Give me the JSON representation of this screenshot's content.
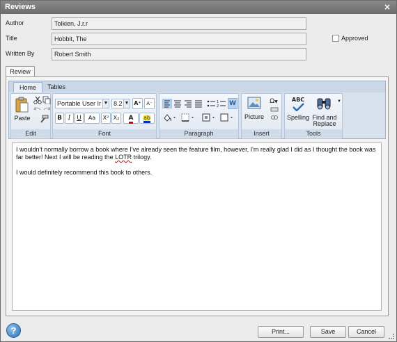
{
  "window": {
    "title": "Reviews",
    "close_glyph": "×"
  },
  "form": {
    "author_label": "Author",
    "author_value": "Tolkien, J.r.r",
    "title_label": "Title",
    "title_value": "Hobbit, The",
    "written_by_label": "Written By",
    "written_by_value": "Robert Smith",
    "approved_label": "Approved",
    "approved_checked": false
  },
  "tabs": {
    "review_tab": "Review"
  },
  "ribbon": {
    "tabs": [
      {
        "label": "Home",
        "active": true
      },
      {
        "label": "Tables",
        "active": false
      }
    ],
    "groups": {
      "edit": {
        "label": "Edit",
        "paste_label": "Paste",
        "icons": [
          "paste-icon",
          "cut-icon",
          "copy-icon",
          "undo-icon",
          "redo-icon",
          "format-painter-icon"
        ]
      },
      "font": {
        "label": "Font",
        "font_name": "Portable User Ir",
        "font_size": "8.2",
        "grow_glyph": "A⁺",
        "shrink_glyph": "A⁻",
        "bold": "B",
        "italic": "I",
        "underline": "U",
        "change_case": "Aa",
        "superscript": "X²",
        "subscript": "X₂",
        "font_color_glyph": "A",
        "highlight_glyph": "ab",
        "font_color": "#cc0000",
        "highlight_color": "#0033cc"
      },
      "paragraph": {
        "label": "Paragraph",
        "icons": [
          "align-left-icon",
          "align-center-icon",
          "align-right-icon",
          "justify-icon",
          "bullets-icon",
          "numbering-icon",
          "show-formatting-icon",
          "shading-icon",
          "borders-icon",
          "indent-icon",
          "outline-icon"
        ],
        "show_formatting_glyph": "W"
      },
      "insert": {
        "label": "Insert",
        "picture_label": "Picture",
        "symbol_glyph": "Ω"
      },
      "tools": {
        "label": "Tools",
        "spelling_label": "Spelling",
        "spelling_glyph": "ABC",
        "find_replace_label_line1": "Find and",
        "find_replace_label_line2": "Replace"
      }
    }
  },
  "editor": {
    "paragraph1_part1": "I wouldn't normally borrow a book where I've already seen the feature film, however, I'm really glad I did as I thought the book was far better! Next I will be reading the ",
    "paragraph1_misspelled": "LOTR",
    "paragraph1_part2": " trilogy.",
    "paragraph2": "I would definitely recommend this book to others."
  },
  "footer": {
    "help_glyph": "?",
    "print_label": "Print...",
    "save_label": "Save",
    "cancel_label": "Cancel"
  }
}
